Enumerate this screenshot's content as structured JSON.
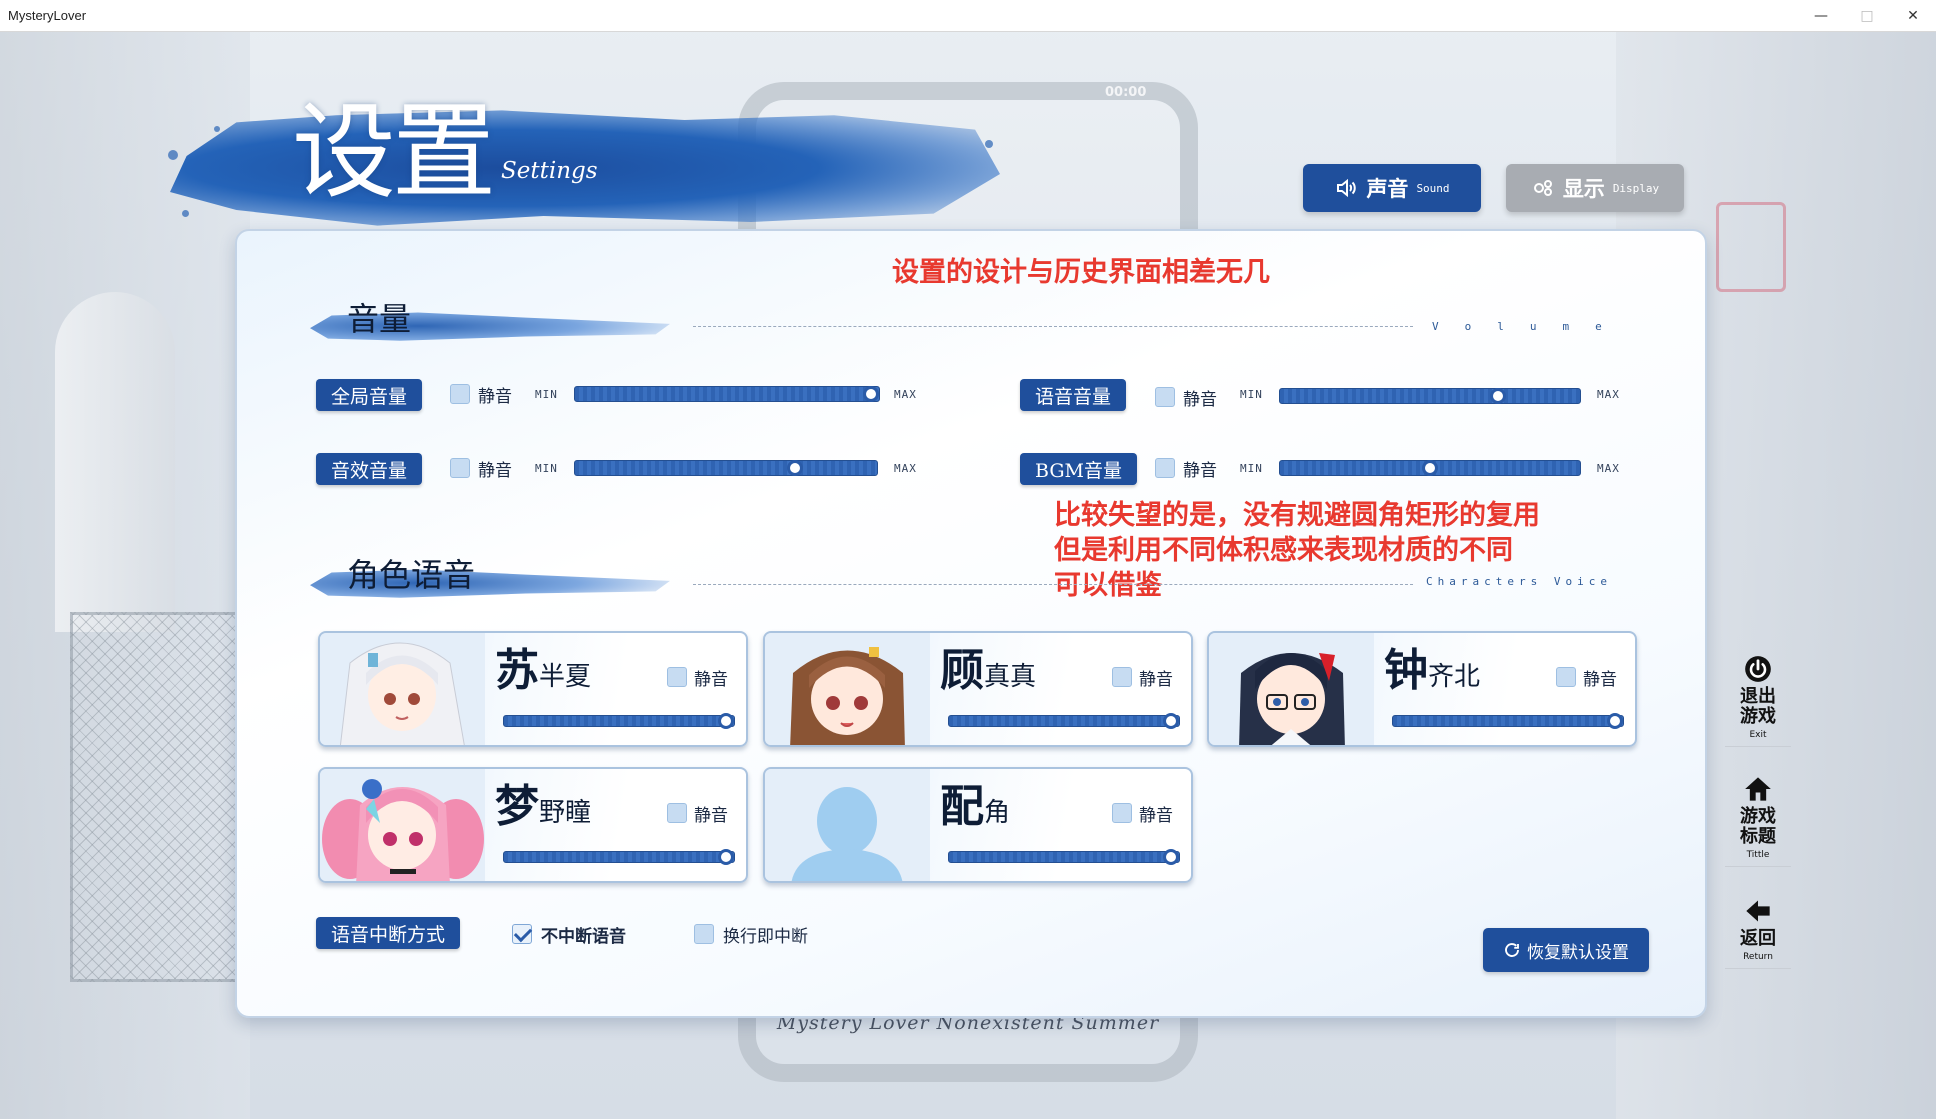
{
  "window": {
    "title": "MysteryLover",
    "controls": [
      "—",
      "□",
      "✕"
    ]
  },
  "background": {
    "phone_time": "00:00",
    "footer_logo": "Mystery Lover Nonexistent Summer"
  },
  "header": {
    "title": "设置",
    "subtitle": "Settings"
  },
  "tabs": [
    {
      "label": "声音",
      "en": "Sound",
      "active": true,
      "icon": "speaker-icon"
    },
    {
      "label": "显示",
      "en": "Display",
      "active": false,
      "icon": "display-settings-icon"
    }
  ],
  "annotations": {
    "top": "设置的设计与历史界面相差无几",
    "middle_line1": "比较失望的是，没有规避圆角矩形的复用",
    "middle_line2": "但是利用不同体积感来表现材质的不同",
    "middle_line3": "可以借鉴"
  },
  "volume_section": {
    "title": "音量",
    "en": "Volume",
    "min_label": "MIN",
    "max_label": "MAX",
    "mute_label": "静音",
    "rows": [
      {
        "label": "全局音量",
        "level": 1.0
      },
      {
        "label": "语音音量",
        "level": 0.74
      },
      {
        "label": "音效音量",
        "level": 0.74
      },
      {
        "label": "BGM音量",
        "level": 0.5
      }
    ]
  },
  "voice_section": {
    "title": "角色语音",
    "en": "Characters Voice",
    "mute_label": "静音",
    "characters": [
      {
        "first": "苏",
        "rest": "半夏",
        "level": 1.0
      },
      {
        "first": "顾",
        "rest": "真真",
        "level": 1.0
      },
      {
        "first": "钟",
        "rest": "齐北",
        "level": 1.0
      },
      {
        "first": "梦",
        "rest": "野瞳",
        "level": 1.0
      },
      {
        "first": "配",
        "rest": "角",
        "level": 1.0
      }
    ]
  },
  "interrupt": {
    "label": "语音中断方式",
    "option1": "不中断语音",
    "option1_checked": true,
    "option2": "换行即中断",
    "option2_checked": false
  },
  "reset_button": "恢复默认设置",
  "sidenav": [
    {
      "cn1": "退出",
      "cn2": "游戏",
      "en": "Exit",
      "icon": "power-icon"
    },
    {
      "cn1": "游戏",
      "cn2": "标题",
      "en": "Tittle",
      "icon": "home-icon"
    },
    {
      "cn1": "返回",
      "cn2": "",
      "en": "Return",
      "icon": "back-arrow-icon"
    }
  ]
}
